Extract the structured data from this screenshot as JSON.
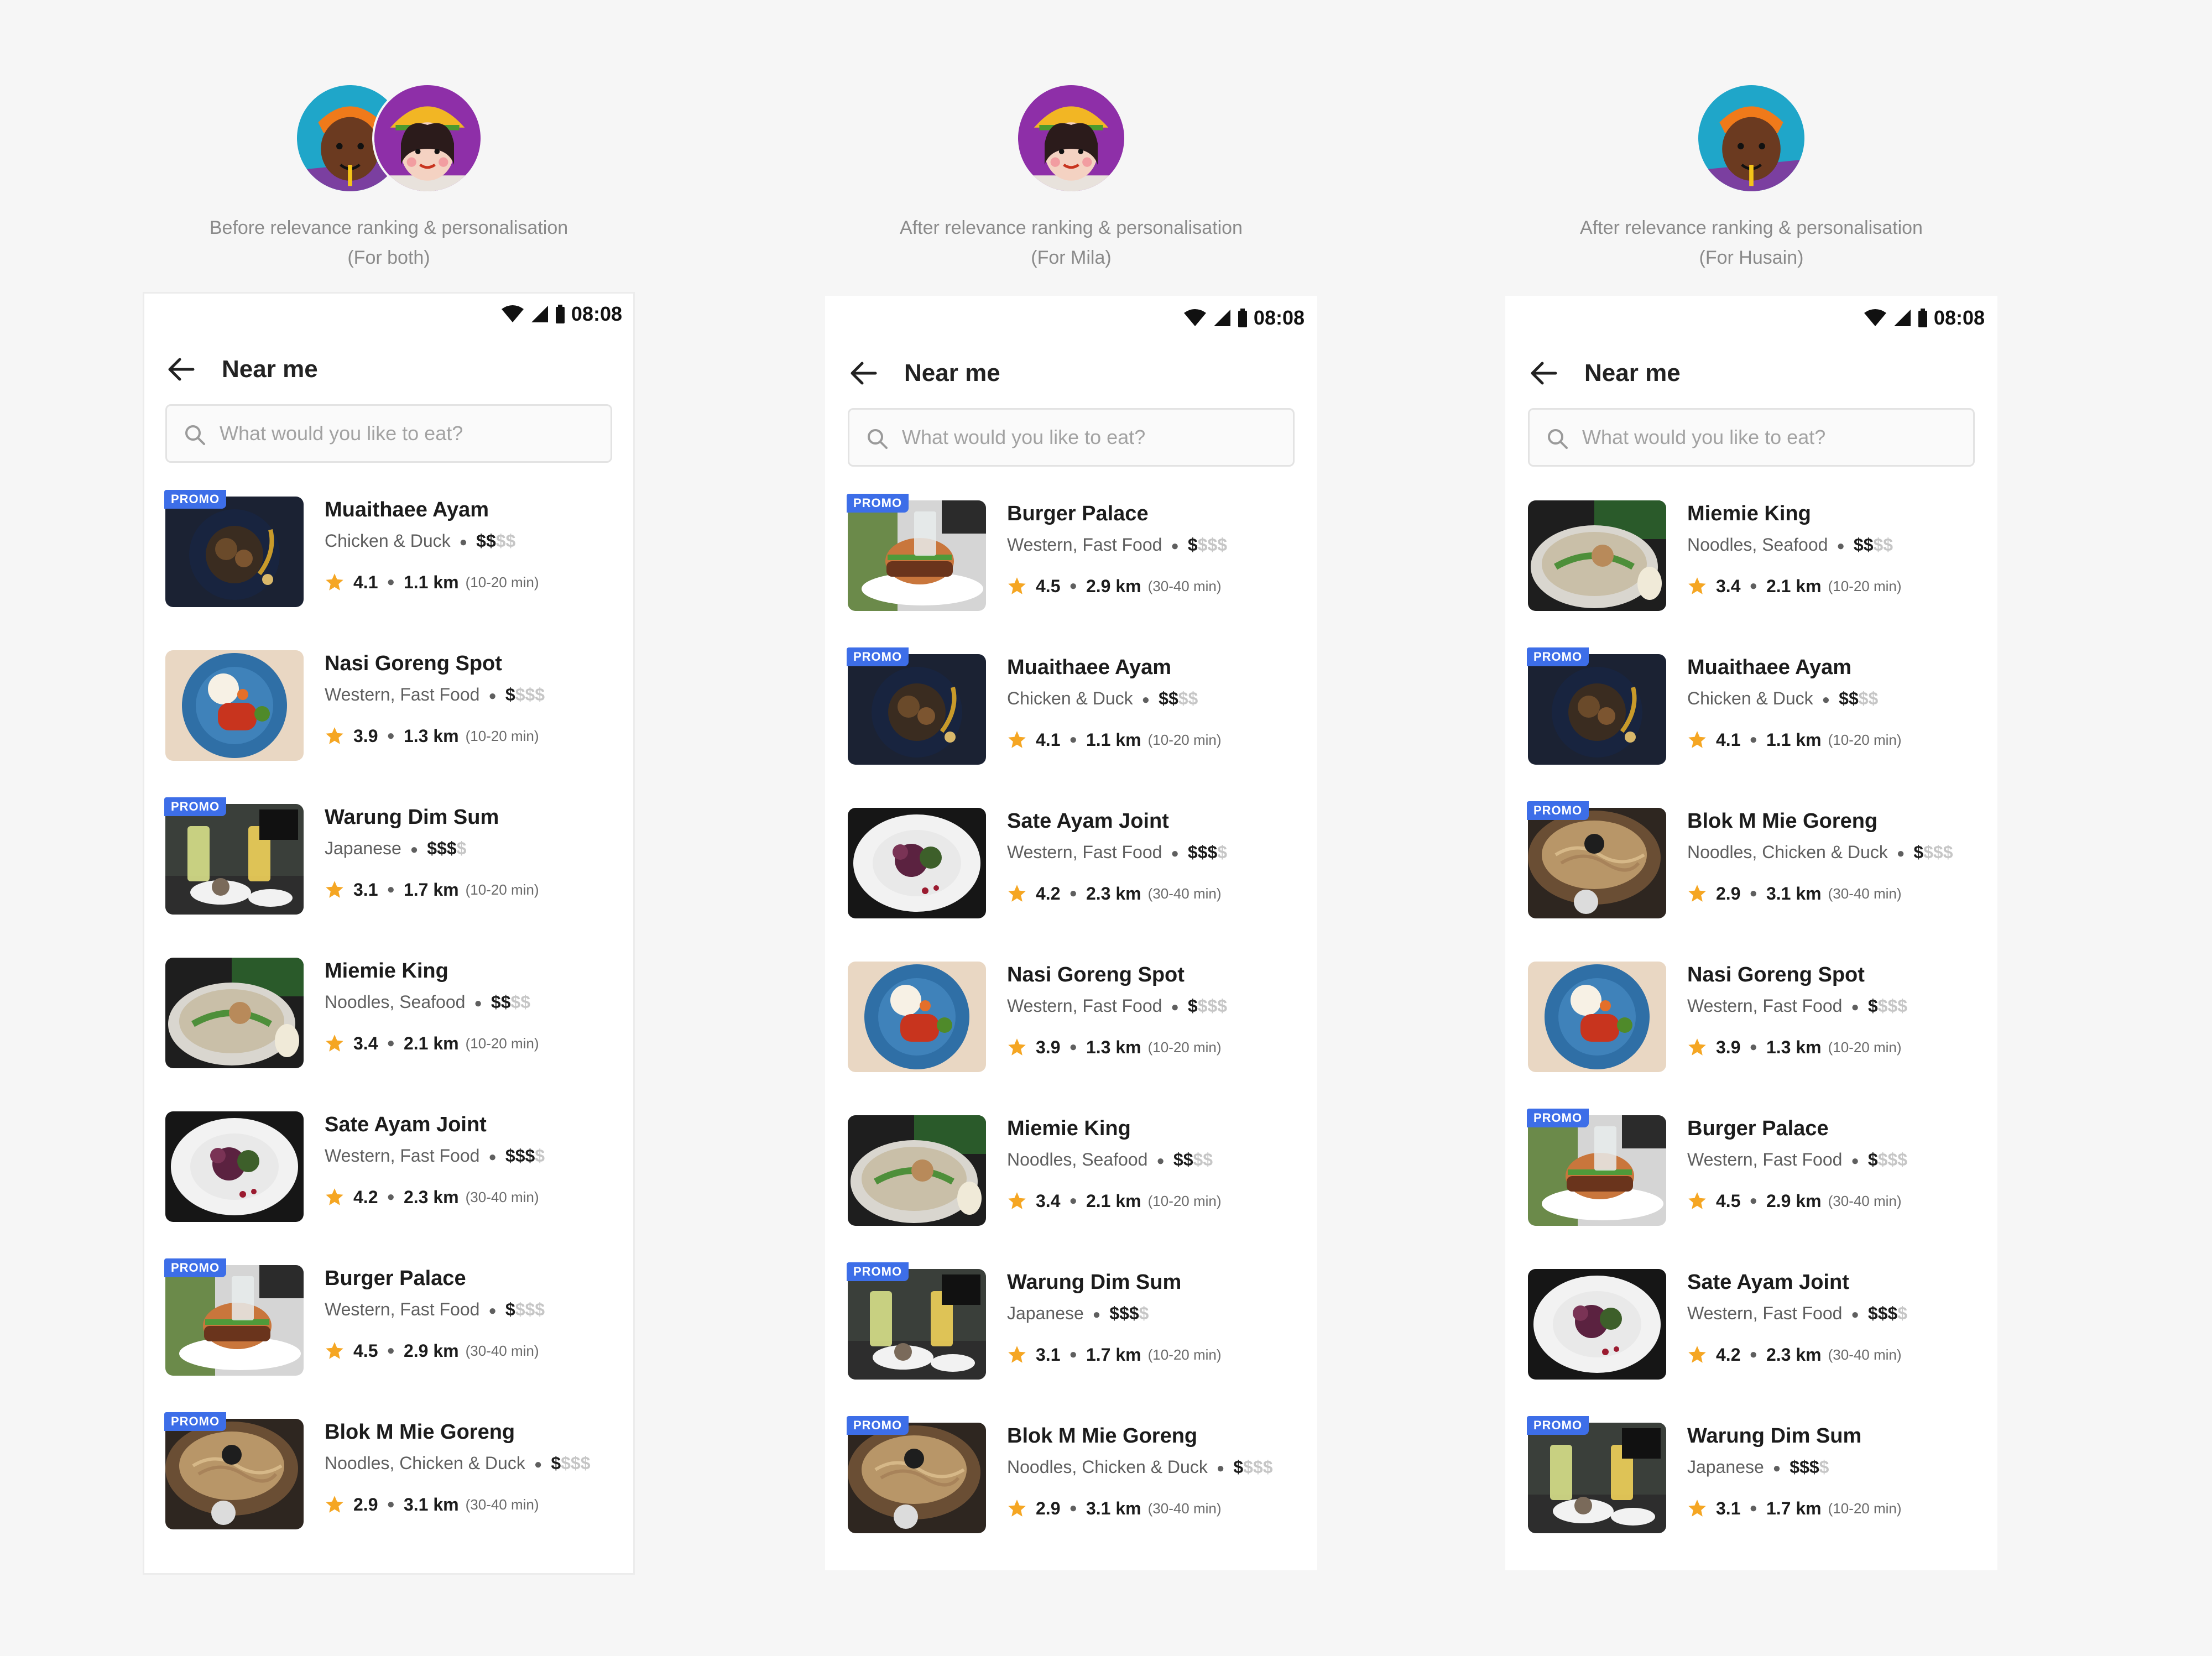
{
  "status_time": "08:08",
  "search_placeholder": "What would you like to eat?",
  "page_title": "Near me",
  "promo_label": "PROMO",
  "personas": {
    "mila": {
      "name": "Mila",
      "skin": "#ffffff",
      "accent": "#8e2fa8"
    },
    "husain": {
      "name": "Husain",
      "accent": "#1fa6c9"
    }
  },
  "columns": [
    {
      "caption_line1": "Before relevance ranking & personalisation",
      "caption_line2": "(For both)",
      "avatars": [
        "husain-avatar",
        "mila-avatar"
      ],
      "restaurants": [
        {
          "name": "Muaithaee Ayam",
          "cuisine": "Chicken & Duck",
          "price_on": "$$",
          "price_off": "$$",
          "rating": "4.1",
          "distance": "1.1 km",
          "eta": "(10-20 min)",
          "promo": true,
          "image": "thai-dish"
        },
        {
          "name": "Nasi Goreng Spot",
          "cuisine": "Western, Fast Food",
          "price_on": "$",
          "price_off": "$$$",
          "rating": "3.9",
          "distance": "1.3 km",
          "eta": "(10-20 min)",
          "promo": false,
          "image": "rice-plate"
        },
        {
          "name": "Warung Dim Sum",
          "cuisine": "Japanese",
          "price_on": "$$$",
          "price_off": "$",
          "rating": "3.1",
          "distance": "1.7 km",
          "eta": "(10-20 min)",
          "promo": true,
          "image": "dimsum-drinks"
        },
        {
          "name": "Miemie King",
          "cuisine": "Noodles, Seafood",
          "price_on": "$$",
          "price_off": "$$",
          "rating": "3.4",
          "distance": "2.1 km",
          "eta": "(10-20 min)",
          "promo": false,
          "image": "noodle-bowl"
        },
        {
          "name": "Sate Ayam Joint",
          "cuisine": "Western, Fast Food",
          "price_on": "$$$",
          "price_off": "$",
          "rating": "4.2",
          "distance": "2.3 km",
          "eta": "(30-40 min)",
          "promo": false,
          "image": "salad-plate"
        },
        {
          "name": "Burger Palace",
          "cuisine": "Western, Fast Food",
          "price_on": "$",
          "price_off": "$$$",
          "rating": "4.5",
          "distance": "2.9 km",
          "eta": "(30-40 min)",
          "promo": true,
          "image": "burger"
        },
        {
          "name": "Blok M Mie Goreng",
          "cuisine": "Noodles, Chicken & Duck",
          "price_on": "$",
          "price_off": "$$$",
          "rating": "2.9",
          "distance": "3.1 km",
          "eta": "(30-40 min)",
          "promo": true,
          "image": "fried-noodles"
        }
      ]
    },
    {
      "caption_line1": "After relevance ranking & personalisation",
      "caption_line2": "(For Mila)",
      "avatars": [
        "mila-avatar"
      ],
      "restaurants": [
        {
          "name": "Burger Palace",
          "cuisine": "Western, Fast Food",
          "price_on": "$",
          "price_off": "$$$",
          "rating": "4.5",
          "distance": "2.9 km",
          "eta": "(30-40 min)",
          "promo": true,
          "image": "burger"
        },
        {
          "name": "Muaithaee Ayam",
          "cuisine": "Chicken & Duck",
          "price_on": "$$",
          "price_off": "$$",
          "rating": "4.1",
          "distance": "1.1 km",
          "eta": "(10-20 min)",
          "promo": true,
          "image": "thai-dish"
        },
        {
          "name": "Sate Ayam Joint",
          "cuisine": "Western, Fast Food",
          "price_on": "$$$",
          "price_off": "$",
          "rating": "4.2",
          "distance": "2.3 km",
          "eta": "(30-40 min)",
          "promo": false,
          "image": "salad-plate"
        },
        {
          "name": "Nasi Goreng Spot",
          "cuisine": "Western, Fast Food",
          "price_on": "$",
          "price_off": "$$$",
          "rating": "3.9",
          "distance": "1.3 km",
          "eta": "(10-20 min)",
          "promo": false,
          "image": "rice-plate"
        },
        {
          "name": "Miemie King",
          "cuisine": "Noodles, Seafood",
          "price_on": "$$",
          "price_off": "$$",
          "rating": "3.4",
          "distance": "2.1 km",
          "eta": "(10-20 min)",
          "promo": false,
          "image": "noodle-bowl"
        },
        {
          "name": "Warung Dim Sum",
          "cuisine": "Japanese",
          "price_on": "$$$",
          "price_off": "$",
          "rating": "3.1",
          "distance": "1.7 km",
          "eta": "(10-20 min)",
          "promo": true,
          "image": "dimsum-drinks"
        },
        {
          "name": "Blok M Mie Goreng",
          "cuisine": "Noodles, Chicken & Duck",
          "price_on": "$",
          "price_off": "$$$",
          "rating": "2.9",
          "distance": "3.1 km",
          "eta": "(30-40 min)",
          "promo": true,
          "image": "fried-noodles"
        }
      ]
    },
    {
      "caption_line1": "After relevance ranking & personalisation",
      "caption_line2": "(For Husain)",
      "avatars": [
        "husain-avatar"
      ],
      "restaurants": [
        {
          "name": "Miemie King",
          "cuisine": "Noodles, Seafood",
          "price_on": "$$",
          "price_off": "$$",
          "rating": "3.4",
          "distance": "2.1 km",
          "eta": "(10-20 min)",
          "promo": false,
          "image": "noodle-bowl"
        },
        {
          "name": "Muaithaee Ayam",
          "cuisine": "Chicken & Duck",
          "price_on": "$$",
          "price_off": "$$",
          "rating": "4.1",
          "distance": "1.1 km",
          "eta": "(10-20 min)",
          "promo": true,
          "image": "thai-dish"
        },
        {
          "name": "Blok M Mie Goreng",
          "cuisine": "Noodles, Chicken & Duck",
          "price_on": "$",
          "price_off": "$$$",
          "rating": "2.9",
          "distance": "3.1 km",
          "eta": "(30-40 min)",
          "promo": true,
          "image": "fried-noodles"
        },
        {
          "name": "Nasi Goreng Spot",
          "cuisine": "Western, Fast Food",
          "price_on": "$",
          "price_off": "$$$",
          "rating": "3.9",
          "distance": "1.3 km",
          "eta": "(10-20 min)",
          "promo": false,
          "image": "rice-plate"
        },
        {
          "name": "Burger Palace",
          "cuisine": "Western, Fast Food",
          "price_on": "$",
          "price_off": "$$$",
          "rating": "4.5",
          "distance": "2.9 km",
          "eta": "(30-40 min)",
          "promo": true,
          "image": "burger"
        },
        {
          "name": "Sate Ayam Joint",
          "cuisine": "Western, Fast Food",
          "price_on": "$$$",
          "price_off": "$",
          "rating": "4.2",
          "distance": "2.3 km",
          "eta": "(30-40 min)",
          "promo": false,
          "image": "salad-plate"
        },
        {
          "name": "Warung Dim Sum",
          "cuisine": "Japanese",
          "price_on": "$$$",
          "price_off": "$",
          "rating": "3.1",
          "distance": "1.7 km",
          "eta": "(10-20 min)",
          "promo": true,
          "image": "dimsum-drinks"
        }
      ]
    }
  ],
  "colors": {
    "promo": "#3d6ee8",
    "star": "#f5a623",
    "price_off": "#c6c6c6",
    "caption": "#8a8a8a"
  }
}
